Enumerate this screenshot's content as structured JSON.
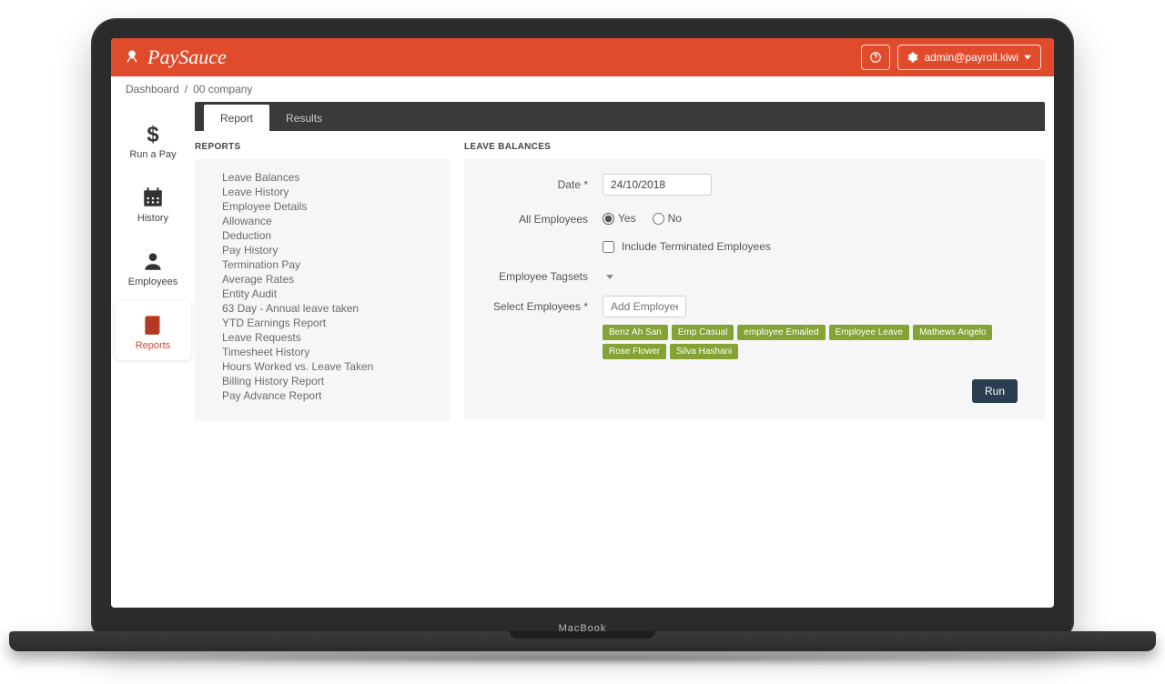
{
  "brand": "PaySauce",
  "device_label": "MacBook",
  "header": {
    "help_tooltip": "Help",
    "user_label": "admin@payroll.kiwi"
  },
  "breadcrumb": {
    "root": "Dashboard",
    "separator": "/",
    "current": "00 company"
  },
  "sidebar": [
    {
      "label": "Run a Pay"
    },
    {
      "label": "History"
    },
    {
      "label": "Employees"
    },
    {
      "label": "Reports"
    }
  ],
  "tabs": {
    "report": "Report",
    "results": "Results"
  },
  "reports_panel": {
    "title": "REPORTS",
    "items": [
      "Leave Balances",
      "Leave History",
      "Employee Details",
      "Allowance",
      "Deduction",
      "Pay History",
      "Termination Pay",
      "Average Rates",
      "Entity Audit",
      "63 Day - Annual leave taken",
      "YTD Earnings Report",
      "Leave Requests",
      "Timesheet History",
      "Hours Worked vs. Leave Taken",
      "Billing History Report",
      "Pay Advance Report"
    ]
  },
  "form": {
    "title": "LEAVE BALANCES",
    "date_label": "Date *",
    "date_value": "24/10/2018",
    "all_employees_label": "All Employees",
    "yes": "Yes",
    "no": "No",
    "include_terminated": "Include Terminated Employees",
    "tagsets_label": "Employee Tagsets",
    "select_employees_label": "Select Employees *",
    "add_placeholder": "Add Employees",
    "tags": [
      "Benz Ah San",
      "Emp Casual",
      "employee Emailed",
      "Employee Leave",
      "Mathews Angelo",
      "Rose Flower",
      "Silva Hashani"
    ],
    "run": "Run"
  }
}
